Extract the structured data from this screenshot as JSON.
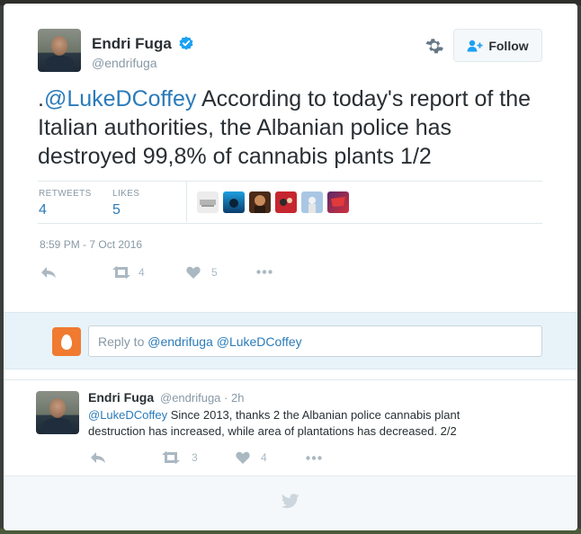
{
  "tweet": {
    "author_name": "Endri Fuga",
    "author_handle": "@endrifuga",
    "follow_label": "Follow",
    "text_prefix": ".",
    "mention": "@LukeDCoffey",
    "text_body": " According to today's report of the Italian authorities, the Albanian police has destroyed 99,8% of cannabis plants 1/2",
    "stats": {
      "retweets_label": "RETWEETS",
      "retweets_value": "4",
      "likes_label": "LIKES",
      "likes_value": "5"
    },
    "timestamp": "8:59 PM - 7 Oct 2016",
    "actions": {
      "retweet_count": "4",
      "like_count": "5"
    }
  },
  "likers": [
    {
      "color": "#d9d9d9",
      "icon": "liker-avatar-1"
    },
    {
      "color": "#1a7fb8",
      "icon": "liker-avatar-2"
    },
    {
      "color": "#8b3a1e",
      "icon": "liker-avatar-3"
    },
    {
      "color": "#c0282f",
      "icon": "liker-avatar-4"
    },
    {
      "color": "#8fb4d6",
      "icon": "liker-avatar-5"
    },
    {
      "color": "#b8303e",
      "icon": "liker-avatar-6"
    }
  ],
  "reply_box": {
    "prefix": "Reply to ",
    "mentions": "@endrifuga @LukeDCoffey"
  },
  "reply_tweet": {
    "author_name": "Endri Fuga",
    "author_handle": "@endrifuga · 2h",
    "mention": "@LukeDCoffey",
    "text_body": " Since 2013, thanks 2 the Albanian police cannabis plant destruction has increased, while area of plantations has decreased. 2/2",
    "retweet_count": "3",
    "like_count": "4"
  },
  "colors": {
    "link": "#2b7bb9",
    "text": "#292f33",
    "muted": "#8899a6",
    "verified": "#1da1f2"
  }
}
